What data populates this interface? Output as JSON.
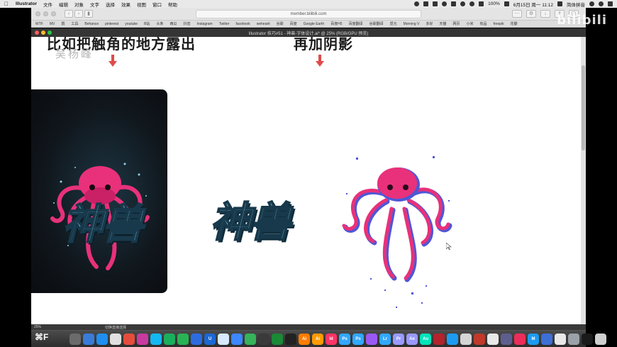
{
  "menubar": {
    "app_name": "Illustrator",
    "items": [
      "文件",
      "编辑",
      "对象",
      "文字",
      "选择",
      "效果",
      "视图",
      "窗口",
      "帮助"
    ],
    "battery": "100%",
    "datetime": "6月15日 周一  11:12",
    "input_method": "简体拼音"
  },
  "safari": {
    "url": "member.bilibili.com",
    "bookmarks": [
      "WTF",
      "MV",
      "撰",
      "工具",
      "Behance",
      "pinterest",
      "youtube",
      "B站",
      "头条",
      "西瓜",
      "抖音",
      "Instagram",
      "Twitter",
      "facebook",
      "wehearit",
      "谷歌",
      "百度",
      "Google Earth",
      "百度H5",
      "百度翻译",
      "谷歌翻译",
      "觅元",
      "Morning V",
      "多好",
      "天猫",
      "网页",
      "小米",
      "有品",
      "freepik",
      "花瓣"
    ]
  },
  "illustrator": {
    "title": "Illustrator 技巧#51 - 神兽-字体设计.ai* @ 25% (RGB/GPU 预览)",
    "zoom": "25%",
    "status": "切换直接选择"
  },
  "canvas": {
    "heading_left": "比如把触角的地方露出",
    "author": "吴杨峰",
    "heading_right": "再加阴影",
    "poster_text": "神兽",
    "middle_text": "神兽"
  },
  "dock": {
    "shortcut": "⌘F",
    "apps": [
      {
        "label": "",
        "color": "#6b6b6b"
      },
      {
        "label": "",
        "color": "#3b7bd8"
      },
      {
        "label": "",
        "color": "#1f8ef0"
      },
      {
        "label": "",
        "color": "#e0e0e0"
      },
      {
        "label": "",
        "color": "#e64c3c"
      },
      {
        "label": "",
        "color": "#c93aa0"
      },
      {
        "label": "",
        "color": "#14b8f2"
      },
      {
        "label": "",
        "color": "#1aaf5d"
      },
      {
        "label": "",
        "color": "#29b355"
      },
      {
        "label": "",
        "color": "#2d6cdf"
      },
      {
        "label": "U",
        "color": "#1c68d6"
      },
      {
        "label": "",
        "color": "#d6e9ff"
      },
      {
        "label": "",
        "color": "#3d87ff"
      },
      {
        "label": "",
        "color": "#36b35b"
      },
      {
        "label": "",
        "color": "#3a3a3a"
      },
      {
        "label": "",
        "color": "#1a8a37"
      },
      {
        "label": "",
        "color": "#222222"
      },
      {
        "label": "Ai",
        "color": "#ff7c00"
      },
      {
        "label": "Ai",
        "color": "#ff9a00"
      },
      {
        "label": "Id",
        "color": "#ff3366"
      },
      {
        "label": "Ps",
        "color": "#31a8ff"
      },
      {
        "label": "Ps",
        "color": "#31a8ff"
      },
      {
        "label": "",
        "color": "#9a59f5"
      },
      {
        "label": "Lr",
        "color": "#31a8ff"
      },
      {
        "label": "Pr",
        "color": "#9999ff"
      },
      {
        "label": "Ae",
        "color": "#9999ff"
      },
      {
        "label": "Au",
        "color": "#00e4bb"
      },
      {
        "label": "",
        "color": "#b3232c"
      },
      {
        "label": "",
        "color": "#1d9bf0"
      },
      {
        "label": "",
        "color": "#d5d5d5"
      },
      {
        "label": "",
        "color": "#c0392b"
      },
      {
        "label": "",
        "color": "#e9e9e9"
      },
      {
        "label": "",
        "color": "#5e5e8e"
      },
      {
        "label": "",
        "color": "#ec2d5a"
      },
      {
        "label": "M",
        "color": "#1e9bf0"
      },
      {
        "label": "",
        "color": "#3d6fd6"
      },
      {
        "label": "",
        "color": "#e8e8e8"
      },
      {
        "label": "",
        "color": "#9aa1a8"
      },
      {
        "label": "",
        "color": "#1a1a1a"
      },
      {
        "label": "",
        "color": "#cfcfcf"
      }
    ]
  },
  "watermark": "bilibili",
  "colors": {
    "arrow": "#e04a4a",
    "octopus_body": "#e8317a",
    "octopus_shadow": "#4f57d6",
    "text_fill": "#8ed6e6",
    "text_stroke": "#17394b"
  }
}
